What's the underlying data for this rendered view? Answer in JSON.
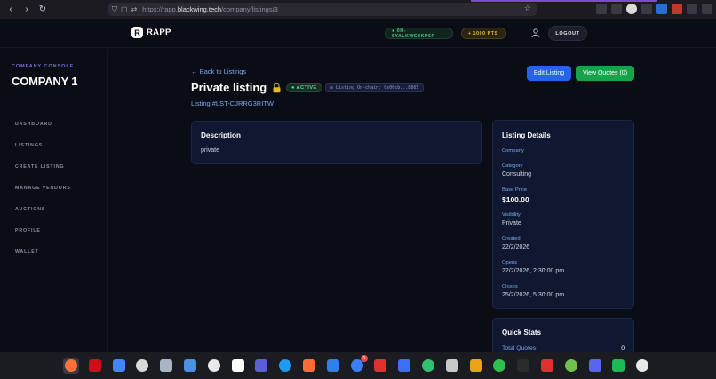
{
  "browser": {
    "url_prefix": "https://rapp.",
    "url_host": "blackwing.tech",
    "url_path": "/company/listings/3"
  },
  "header": {
    "logo_letter": "R",
    "logo_text": "RAPP",
    "wallet_label": "● 0H-6YALKWE3KP6P",
    "points_label": "+ 1000 PTS",
    "logout_label": "LOGOUT"
  },
  "sidebar": {
    "console_label": "COMPANY CONSOLE",
    "company_name": "COMPANY 1",
    "items": [
      {
        "label": "DASHBOARD"
      },
      {
        "label": "LISTINGS"
      },
      {
        "label": "CREATE LISTING"
      },
      {
        "label": "MANAGE VENDORS"
      },
      {
        "label": "AUCTIONS"
      },
      {
        "label": "PROFILE"
      },
      {
        "label": "WALLET"
      }
    ]
  },
  "main": {
    "back_label": "← Back to Listings",
    "title": "Private listing",
    "status": "● ACTIVE",
    "onchain": "⊘ Listing On-chain: 0x00cb...8865",
    "listing_id": "Listing #LST-CJRRG3RITW",
    "edit_label": "Edit Listing",
    "quotes_label": "View Quotes (0)",
    "description": {
      "heading": "Description",
      "text": "private"
    },
    "details": {
      "heading": "Listing Details",
      "company_label": "Company",
      "category_label": "Category",
      "category_value": "Consulting",
      "price_label": "Base Price",
      "price_value": "$100.00",
      "visibility_label": "Visibility",
      "visibility_value": "Private",
      "created_label": "Created",
      "created_value": "22/2/2026",
      "opens_label": "Opens",
      "opens_value": "22/2/2026, 2:30:00 pm",
      "closes_label": "Closes",
      "closes_value": "25/2/2026, 5:30:00 pm"
    },
    "stats": {
      "heading": "Quick Stats",
      "total_quotes_label": "Total Quotes:",
      "total_quotes_value": "0"
    }
  },
  "dock": {
    "badge_count": "3",
    "colors": [
      "#ff7139",
      "#cc0f16",
      "#4285f4",
      "#d9d9d9",
      "#aab4c3",
      "#4a90e2",
      "#e8e8e8",
      "#ffffff",
      "#5a5fd6",
      "#1d9bf0",
      "#ff6b35",
      "#2f80ed",
      "#3d7eff",
      "#e03131",
      "#3d6ef5",
      "#2fbf71",
      "#c8c8c8",
      "#e8a317",
      "#2fbf4f",
      "#2b2b2b",
      "#e03131",
      "#6fc04e",
      "#5865f2",
      "#1db954",
      "#e8e8e8"
    ]
  }
}
